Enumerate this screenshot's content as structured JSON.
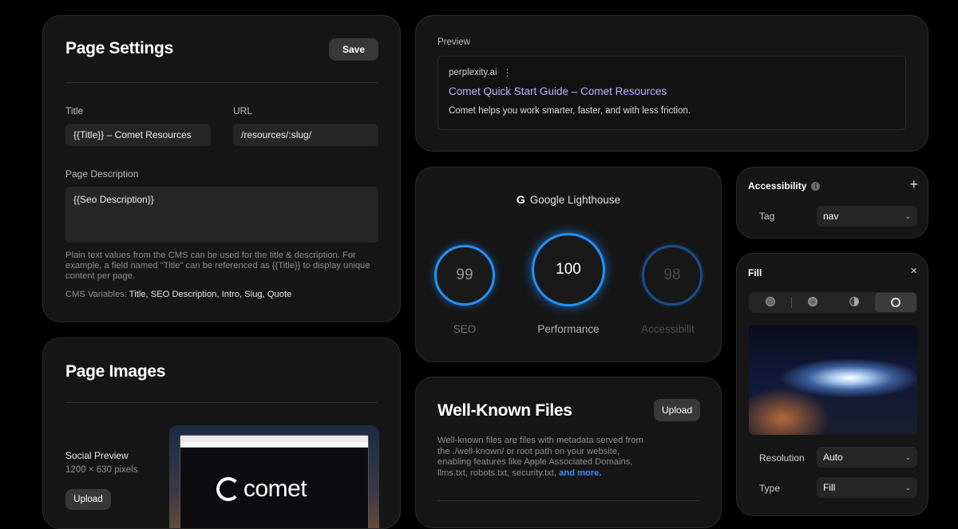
{
  "page_settings": {
    "title": "Page Settings",
    "save_label": "Save",
    "title_label": "Title",
    "title_value": "{{Title}} – Comet Resources",
    "url_label": "URL",
    "url_value": "/resources/:slug/",
    "desc_label": "Page Description",
    "desc_value": "{{Seo Description}}",
    "help_text": "Plain text values from the CMS can be used for the title & description. For example, a field named \"Title\" can be referenced as {{Title}} to display unique content per page.",
    "cms_vars_label": "CMS Variables:",
    "cms_vars_value": "Title, SEO Description, Intro, Slug, Quote"
  },
  "preview": {
    "label": "Preview",
    "domain": "perplexity.ai",
    "link": "Comet Quick Start Guide – Comet Resources",
    "desc": "Comet helps you work smarter, faster, and with less friction."
  },
  "lighthouse": {
    "title": "Google Lighthouse",
    "scores": [
      {
        "label": "SEO",
        "value": "99"
      },
      {
        "label": "Performance",
        "value": "100"
      },
      {
        "label": "Accessibilit",
        "value": "98"
      }
    ]
  },
  "accessibility": {
    "title": "Accessibility",
    "tag_label": "Tag",
    "tag_value": "nav"
  },
  "fill": {
    "title": "Fill",
    "resolution_label": "Resolution",
    "resolution_value": "Auto",
    "type_label": "Type",
    "type_value": "Fill"
  },
  "page_images": {
    "title": "Page Images",
    "social_label": "Social Preview",
    "social_size": "1200 × 630 pixels",
    "upload_label": "Upload",
    "brand_text": "comet"
  },
  "well_known": {
    "title": "Well-Known Files",
    "upload_label": "Upload",
    "desc": "Well-known files are files with metadata served from the ./well-known/ or root path on your website, enabling features like Apple Associated Domains, llms.txt, robots.txt, security.txt,",
    "more_link": "and more."
  },
  "colors": {
    "accent": "#1e90ff",
    "link": "#b9b4ff",
    "bg": "#000000",
    "card": "#161616"
  }
}
